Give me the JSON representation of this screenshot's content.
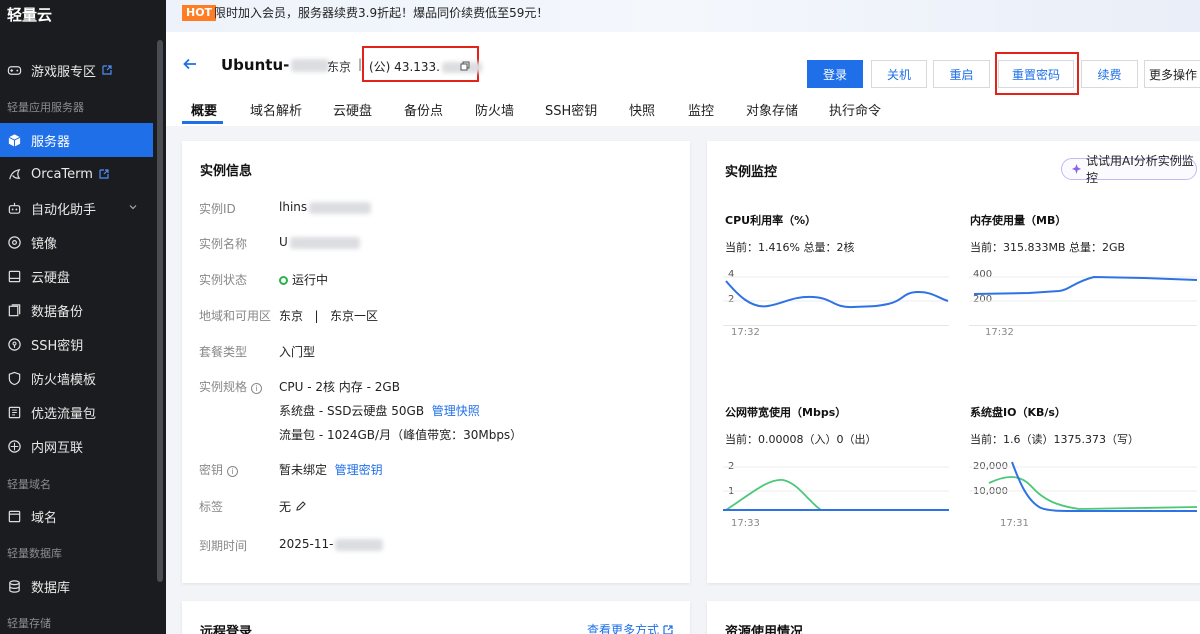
{
  "sidebar": {
    "brand": "轻量云",
    "items": [
      {
        "label": "游戏服专区"
      },
      {
        "label": "服务器"
      },
      {
        "label": "OrcaTerm"
      },
      {
        "label": "自动化助手"
      },
      {
        "label": "镜像"
      },
      {
        "label": "云硬盘"
      },
      {
        "label": "数据备份"
      },
      {
        "label": "SSH密钥"
      },
      {
        "label": "防火墙模板"
      },
      {
        "label": "优选流量包"
      },
      {
        "label": "内网互联"
      },
      {
        "label": "域名"
      },
      {
        "label": "数据库"
      }
    ],
    "sections": [
      "轻量应用服务器",
      "轻量域名",
      "轻量数据库",
      "轻量存储"
    ]
  },
  "banner": {
    "badge": "HOT",
    "text": "限时加入会员，服务器续费3.9折起！爆品同价续费低至59元！"
  },
  "header": {
    "name": "Ubuntu-",
    "region": "东京",
    "divider": "|",
    "ip": "(公) 43.133.",
    "buttons": {
      "login": "登录",
      "shutdown": "关机",
      "restart": "重启",
      "reset_password": "重置密码",
      "renew": "续费",
      "more": "更多操作"
    },
    "tabs": [
      "概要",
      "域名解析",
      "云硬盘",
      "备份点",
      "防火墙",
      "SSH密钥",
      "快照",
      "监控",
      "对象存储",
      "执行命令"
    ]
  },
  "instance_info": {
    "title": "实例信息",
    "rows": {
      "id": {
        "label": "实例ID",
        "value": "lhins"
      },
      "name": {
        "label": "实例名称",
        "value": "U"
      },
      "status": {
        "label": "实例状态",
        "value": "运行中"
      },
      "region": {
        "label": "地域和可用区",
        "value": "东京",
        "sep": "|",
        "zone": "东京一区"
      },
      "plan": {
        "label": "套餐类型",
        "value": "入门型"
      },
      "spec": {
        "label": "实例规格",
        "line1": "CPU - 2核 内存 - 2GB",
        "line2": "系统盘 - SSD云硬盘 50GB",
        "line2_link": "管理快照",
        "line3": "流量包 - 1024GB/月（峰值带宽：30Mbps）"
      },
      "key": {
        "label": "密钥",
        "value": "暂未绑定",
        "link": "管理密钥"
      },
      "tag": {
        "label": "标签",
        "value": "无"
      },
      "expire": {
        "label": "到期时间",
        "value": "2025-11-"
      }
    }
  },
  "monitor": {
    "title": "实例监控",
    "ai_button": "试试用AI分析实例监控",
    "charts": [
      {
        "title": "CPU利用率（%）",
        "current": "当前：1.416% 总量：2核",
        "ticks": [
          "4",
          "2"
        ],
        "time": "17:32"
      },
      {
        "title": "内存使用量（MB）",
        "current": "当前：315.833MB 总量：2GB",
        "ticks": [
          "400",
          "200"
        ],
        "time": "17:32"
      },
      {
        "title": "公网带宽使用（Mbps）",
        "current": "当前：0.00008（入）0（出）",
        "ticks": [
          "2",
          "1"
        ],
        "time": "17:33"
      },
      {
        "title": "系统盘IO（KB/s）",
        "current": "当前：1.6（读）1375.373（写）",
        "ticks": [
          "20,000",
          "10,000"
        ],
        "time": "17:31"
      }
    ]
  },
  "bottom": {
    "remote_title": "远程登录",
    "remote_link": "查看更多方式",
    "resource_title": "资源使用情况"
  },
  "colors": {
    "accent": "#1f6fe8",
    "sidebar_bg": "#1b1c1f",
    "highlight_red": "#e2231a",
    "running_green": "#2bb24c",
    "series_green": "#4cc87a"
  }
}
